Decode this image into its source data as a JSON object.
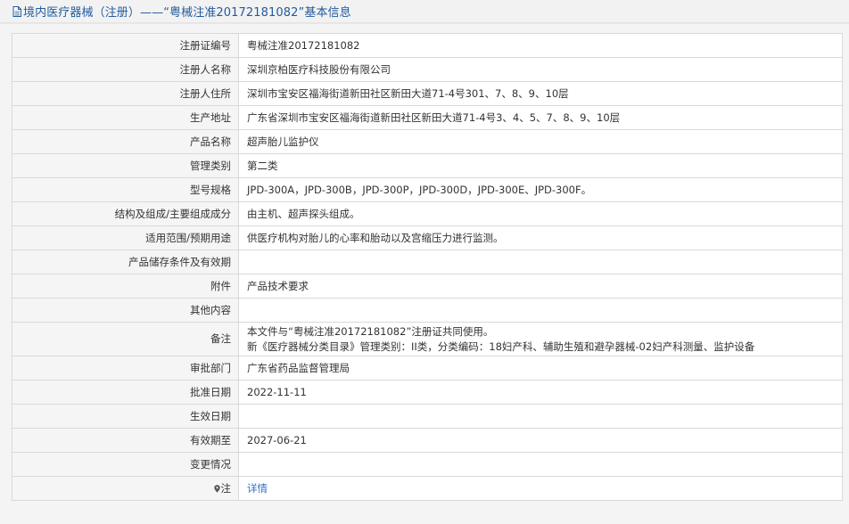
{
  "header": {
    "title": "境内医疗器械（注册）——“粤械注准20172181082”基本信息",
    "icon": "document-icon"
  },
  "rows": [
    {
      "label": "注册证编号",
      "value": "粤械注准20172181082"
    },
    {
      "label": "注册人名称",
      "value": "深圳京柏医疗科技股份有限公司"
    },
    {
      "label": "注册人住所",
      "value": "深圳市宝安区福海街道新田社区新田大道71-4号301、7、8、9、10层"
    },
    {
      "label": "生产地址",
      "value": "广东省深圳市宝安区福海街道新田社区新田大道71-4号3、4、5、7、8、9、10层"
    },
    {
      "label": "产品名称",
      "value": "超声胎儿监护仪"
    },
    {
      "label": "管理类别",
      "value": "第二类"
    },
    {
      "label": "型号规格",
      "value": "JPD-300A，JPD-300B，JPD-300P，JPD-300D，JPD-300E、JPD-300F。"
    },
    {
      "label": "结构及组成/主要组成成分",
      "value": "由主机、超声探头组成。"
    },
    {
      "label": "适用范围/预期用途",
      "value": "供医疗机构对胎儿的心率和胎动以及宫缩压力进行监测。"
    },
    {
      "label": "产品储存条件及有效期",
      "value": ""
    },
    {
      "label": "附件",
      "value": "产品技术要求"
    },
    {
      "label": "其他内容",
      "value": ""
    },
    {
      "label": "备注",
      "value_line1": "本文件与“粤械注准20172181082”注册证共同使用。",
      "value_line2": "新《医疗器械分类目录》管理类别：II类，分类编码：18妇产科、辅助生殖和避孕器械-02妇产科测量、监护设备"
    },
    {
      "label": "审批部门",
      "value": "广东省药品监督管理局"
    },
    {
      "label": "批准日期",
      "value": "2022-11-11"
    },
    {
      "label": "生效日期",
      "value": ""
    },
    {
      "label": "有效期至",
      "value": "2027-06-21"
    },
    {
      "label": "变更情况",
      "value": ""
    },
    {
      "label": "注",
      "icon": "map-pin-icon",
      "link_text": "详情"
    }
  ],
  "colors": {
    "header_text": "#225b9e",
    "link": "#2a72c8",
    "label_bg": "#f5f5f5",
    "border": "#d9d9d9"
  }
}
